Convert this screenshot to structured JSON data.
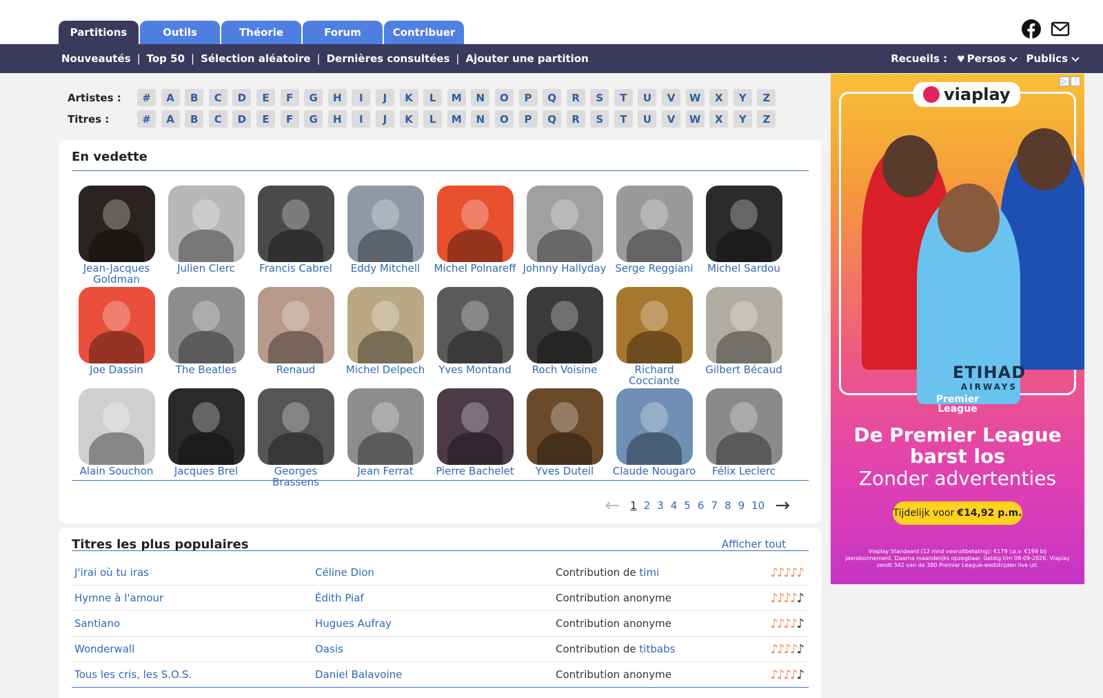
{
  "tabs": [
    "Partitions",
    "Outils",
    "Théorie",
    "Forum",
    "Contribuer"
  ],
  "top_icons": [
    "facebook-icon",
    "mail-icon"
  ],
  "nav": {
    "links": [
      "Nouveautés",
      "Top 50",
      "Sélection aléatoire",
      "Dernières consultées",
      "Ajouter une partition"
    ],
    "separator": "|",
    "recueils_label": "Recueils :",
    "persos": "Persos",
    "publics": "Publics"
  },
  "alphabet": {
    "artists_label": "Artistes :",
    "titles_label": "Titres :",
    "letters": [
      "#",
      "A",
      "B",
      "C",
      "D",
      "E",
      "F",
      "G",
      "H",
      "I",
      "J",
      "K",
      "L",
      "M",
      "N",
      "O",
      "P",
      "Q",
      "R",
      "S",
      "T",
      "U",
      "V",
      "W",
      "X",
      "Y",
      "Z"
    ]
  },
  "vedette": {
    "title": "En vedette",
    "artists": [
      {
        "name": "Jean-Jacques Goldman",
        "color": "#2a2320"
      },
      {
        "name": "Julien Clerc",
        "color": "#b8b8b8"
      },
      {
        "name": "Francis Cabrel",
        "color": "#4a4a4a"
      },
      {
        "name": "Eddy Mitchell",
        "color": "#8f98a6"
      },
      {
        "name": "Michel Polnareff",
        "color": "#e8502e"
      },
      {
        "name": "Johnny Hallyday",
        "color": "#a0a0a0"
      },
      {
        "name": "Serge Reggiani",
        "color": "#9a9a9a"
      },
      {
        "name": "Michel Sardou",
        "color": "#2b2b2b"
      },
      {
        "name": "Joe Dassin",
        "color": "#e94f3a"
      },
      {
        "name": "The Beatles",
        "color": "#8d8d8d"
      },
      {
        "name": "Renaud",
        "color": "#b79a8a"
      },
      {
        "name": "Michel Delpech",
        "color": "#b9a883"
      },
      {
        "name": "Yves Montand",
        "color": "#5a5a5a"
      },
      {
        "name": "Roch Voisine",
        "color": "#3a3a3a"
      },
      {
        "name": "Richard Cocciante",
        "color": "#a8772f"
      },
      {
        "name": "Gilbert Bécaud",
        "color": "#b0aca2"
      },
      {
        "name": "Alain Souchon",
        "color": "#cfcfcf"
      },
      {
        "name": "Jacques Brel",
        "color": "#2a2a2a"
      },
      {
        "name": "Georges Brassens",
        "color": "#555555"
      },
      {
        "name": "Jean Ferrat",
        "color": "#8d8d8d"
      },
      {
        "name": "Pierre Bachelet",
        "color": "#4a3b46"
      },
      {
        "name": "Yves Duteil",
        "color": "#6b4a2a"
      },
      {
        "name": "Claude Nougaro",
        "color": "#6f8fb5"
      },
      {
        "name": "Félix Leclerc",
        "color": "#8a8a8a"
      }
    ],
    "pages": [
      "1",
      "2",
      "3",
      "4",
      "5",
      "6",
      "7",
      "8",
      "9",
      "10"
    ],
    "current_page": "1",
    "prev_arrow": "←",
    "next_arrow": "→"
  },
  "popular": {
    "title": "Titres les plus populaires",
    "show_all": "Afficher tout",
    "rows": [
      {
        "title": "J'irai où tu iras",
        "artist": "Céline Dion",
        "contrib": "Contribution de ",
        "contributor": "timi",
        "rating": 5
      },
      {
        "title": "Hymne à l'amour",
        "artist": "Édith Piaf",
        "contrib": "Contribution anonyme",
        "contributor": "",
        "rating": 4
      },
      {
        "title": "Santiano",
        "artist": "Hugues Aufray",
        "contrib": "Contribution anonyme",
        "contributor": "",
        "rating": 4
      },
      {
        "title": "Wonderwall",
        "artist": "Oasis",
        "contrib": "Contribution de ",
        "contributor": "titbabs",
        "rating": 4
      },
      {
        "title": "Tous les cris, les S.O.S.",
        "artist": "Daniel Balavoine",
        "contrib": "Contribution anonyme",
        "contributor": "",
        "rating": 4
      }
    ]
  },
  "ad": {
    "brand": "viaplay",
    "sponsor": "ETIHAD",
    "sponsor_sub": "AIRWAYS",
    "league": "Premier\nLeague",
    "headline": "De Premier League barst los",
    "subline": "Zonder advertenties",
    "cta_prefix": "Tijdelijk voor",
    "cta_price": "€14,92 p.m.",
    "fine_print": "Viaplay Standaard (12 mnd vooruitbetaling): €179 i.p.v. €199 bij jaarabonnement. Daarna maandelijks opzegbaar. Geldig t/m 08-09-2026. Viaplay zendt 342 van de 380 Premier League-wedstrijden live uit."
  }
}
